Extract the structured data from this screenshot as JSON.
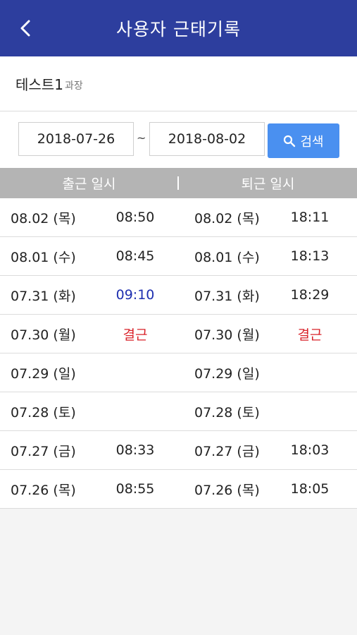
{
  "header": {
    "title": "사용자 근태기록"
  },
  "user": {
    "name": "테스트1",
    "rank": "과장"
  },
  "search": {
    "from": "2018-07-26",
    "separator": "~",
    "to": "2018-08-02",
    "button_label": "검색"
  },
  "table": {
    "col_in": "출근 일시",
    "col_out": "퇴근 일시",
    "rows": [
      {
        "in_date": "08.02 (목)",
        "in_time": "08:50",
        "in_status": "normal",
        "out_date": "08.02 (목)",
        "out_time": "18:11",
        "out_status": "normal"
      },
      {
        "in_date": "08.01 (수)",
        "in_time": "08:45",
        "in_status": "normal",
        "out_date": "08.01 (수)",
        "out_time": "18:13",
        "out_status": "normal"
      },
      {
        "in_date": "07.31 (화)",
        "in_time": "09:10",
        "in_status": "late",
        "out_date": "07.31 (화)",
        "out_time": "18:29",
        "out_status": "normal"
      },
      {
        "in_date": "07.30 (월)",
        "in_time": "결근",
        "in_status": "absent",
        "out_date": "07.30 (월)",
        "out_time": "결근",
        "out_status": "absent"
      },
      {
        "in_date": "07.29 (일)",
        "in_time": "",
        "in_status": "normal",
        "out_date": "07.29 (일)",
        "out_time": "",
        "out_status": "normal"
      },
      {
        "in_date": "07.28 (토)",
        "in_time": "",
        "in_status": "normal",
        "out_date": "07.28 (토)",
        "out_time": "",
        "out_status": "normal"
      },
      {
        "in_date": "07.27 (금)",
        "in_time": "08:33",
        "in_status": "normal",
        "out_date": "07.27 (금)",
        "out_time": "18:03",
        "out_status": "normal"
      },
      {
        "in_date": "07.26 (목)",
        "in_time": "08:55",
        "in_status": "normal",
        "out_date": "07.26 (목)",
        "out_time": "18:05",
        "out_status": "normal"
      }
    ]
  },
  "colors": {
    "header_bg": "#2d3e9e",
    "button_bg": "#4a90f0",
    "late": "#1e2fb0",
    "absent": "#d9232a",
    "table_header_bg": "#b4b4b4"
  },
  "icons": {
    "back": "chevron-left-icon",
    "search": "search-icon"
  }
}
